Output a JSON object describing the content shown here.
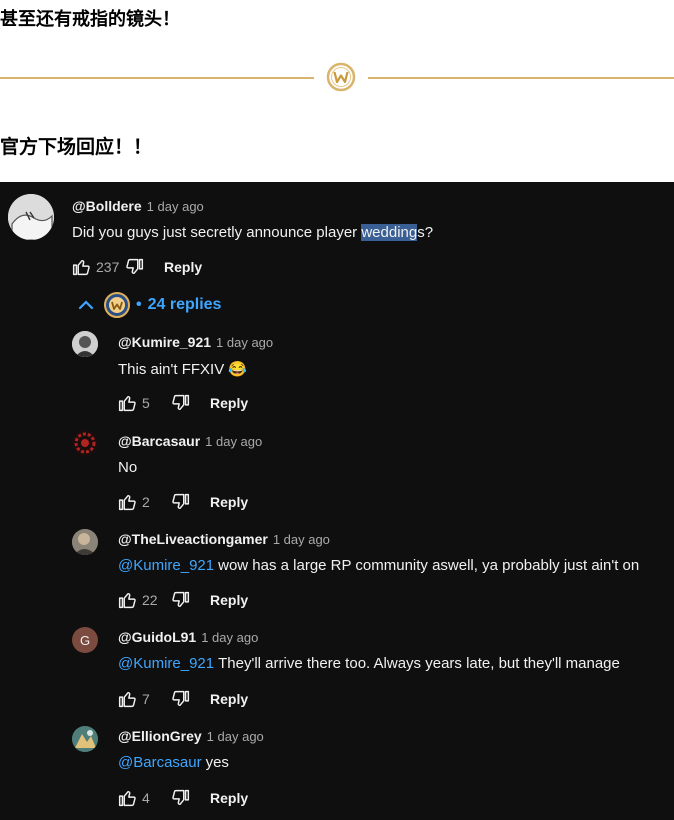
{
  "article": {
    "line1": "甚至还有戒指的镜头！",
    "line2": "官方下场回应！！"
  },
  "colors": {
    "background": "#0f0f0f",
    "text": "#f1f1f1",
    "meta": "#aaaaaa",
    "link": "#3ea6ff",
    "highlight": "#3a5f95",
    "gold": "#d9b46c"
  },
  "comment": {
    "handle": "@Bolldere",
    "time": "1 day ago",
    "text_before": "Did you guys just secretly announce player ",
    "text_highlight": "wedding",
    "text_after": "s?",
    "likes": "237",
    "reply_label": "Reply",
    "replies_count": "24 replies",
    "replies_separator": "•"
  },
  "replies": [
    {
      "handle": "@Kumire_921",
      "time": "1 day ago",
      "mention": "",
      "text": "This ain't FFXIV 😂",
      "likes": "5",
      "reply_label": "Reply",
      "avatar_letter": ""
    },
    {
      "handle": "@Barcasaur",
      "time": "1 day ago",
      "mention": "",
      "text": "No",
      "likes": "2",
      "reply_label": "Reply",
      "avatar_letter": ""
    },
    {
      "handle": "@TheLiveactiongamer",
      "time": "1 day ago",
      "mention": "@Kumire_921",
      "text": "wow has a large RP community aswell, ya probably just ain't on",
      "likes": "22",
      "reply_label": "Reply",
      "avatar_letter": ""
    },
    {
      "handle": "@GuidoL91",
      "time": "1 day ago",
      "mention": "@Kumire_921",
      "text": "They'll arrive there too. Always years late, but they'll manage",
      "likes": "7",
      "reply_label": "Reply",
      "avatar_letter": "G"
    },
    {
      "handle": "@EllionGrey",
      "time": "1 day ago",
      "mention": "@Barcasaur",
      "text": "yes",
      "likes": "4",
      "reply_label": "Reply",
      "avatar_letter": ""
    }
  ],
  "icons": {
    "like": "thumbs-up-icon",
    "dislike": "thumbs-down-icon",
    "collapse": "chevron-up-icon",
    "channel": "warcraft-emblem-icon"
  }
}
